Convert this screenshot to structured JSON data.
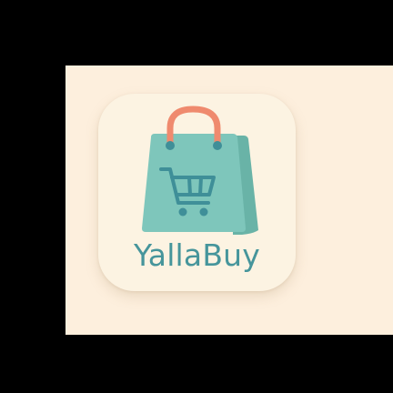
{
  "app": {
    "name": "YallaBuy",
    "icon": "shopping-bag-with-cart"
  },
  "colors": {
    "canvas_bg": "#fdefdd",
    "tile_bg": "#fcf3e2",
    "bag": "#7ec6bb",
    "bag_side": "#69b3a7",
    "handle": "#ef8a6e",
    "cart": "#3f8f98",
    "wordmark": "#46959b"
  }
}
